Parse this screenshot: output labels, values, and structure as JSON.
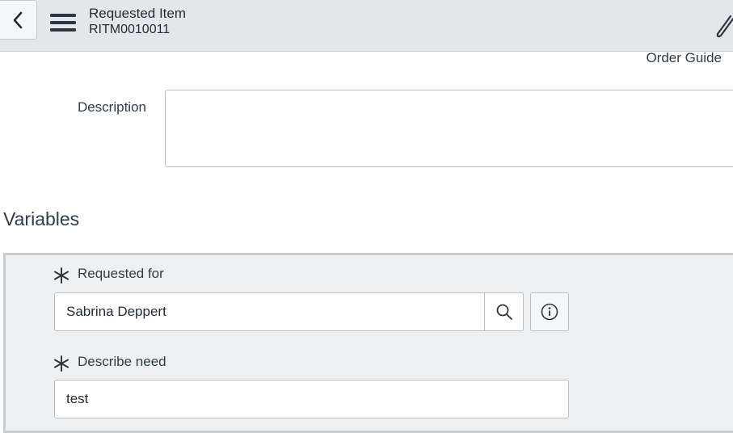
{
  "header": {
    "title": "Requested Item",
    "number": "RITM0010011",
    "icons": {
      "back": "chevron-left-icon",
      "menu": "hamburger-menu-icon",
      "attach": "paperclip-icon"
    }
  },
  "form": {
    "order_guide_label": "Order Guide",
    "description_label": "Description",
    "description_value": ""
  },
  "variables": {
    "section_title": "Variables",
    "requested_for": {
      "label": "Requested for",
      "value": "Sabrina Deppert",
      "icons": {
        "required": "asterisk-icon",
        "lookup": "search-icon",
        "info": "info-icon"
      }
    },
    "describe_need": {
      "label": "Describe need",
      "value": "test",
      "icons": {
        "required": "asterisk-icon"
      }
    }
  },
  "colors": {
    "header_bg": "#e4e7ea",
    "panel_bg": "#eef0f2",
    "text": "#2e3d49",
    "border": "#b8bdc2"
  }
}
